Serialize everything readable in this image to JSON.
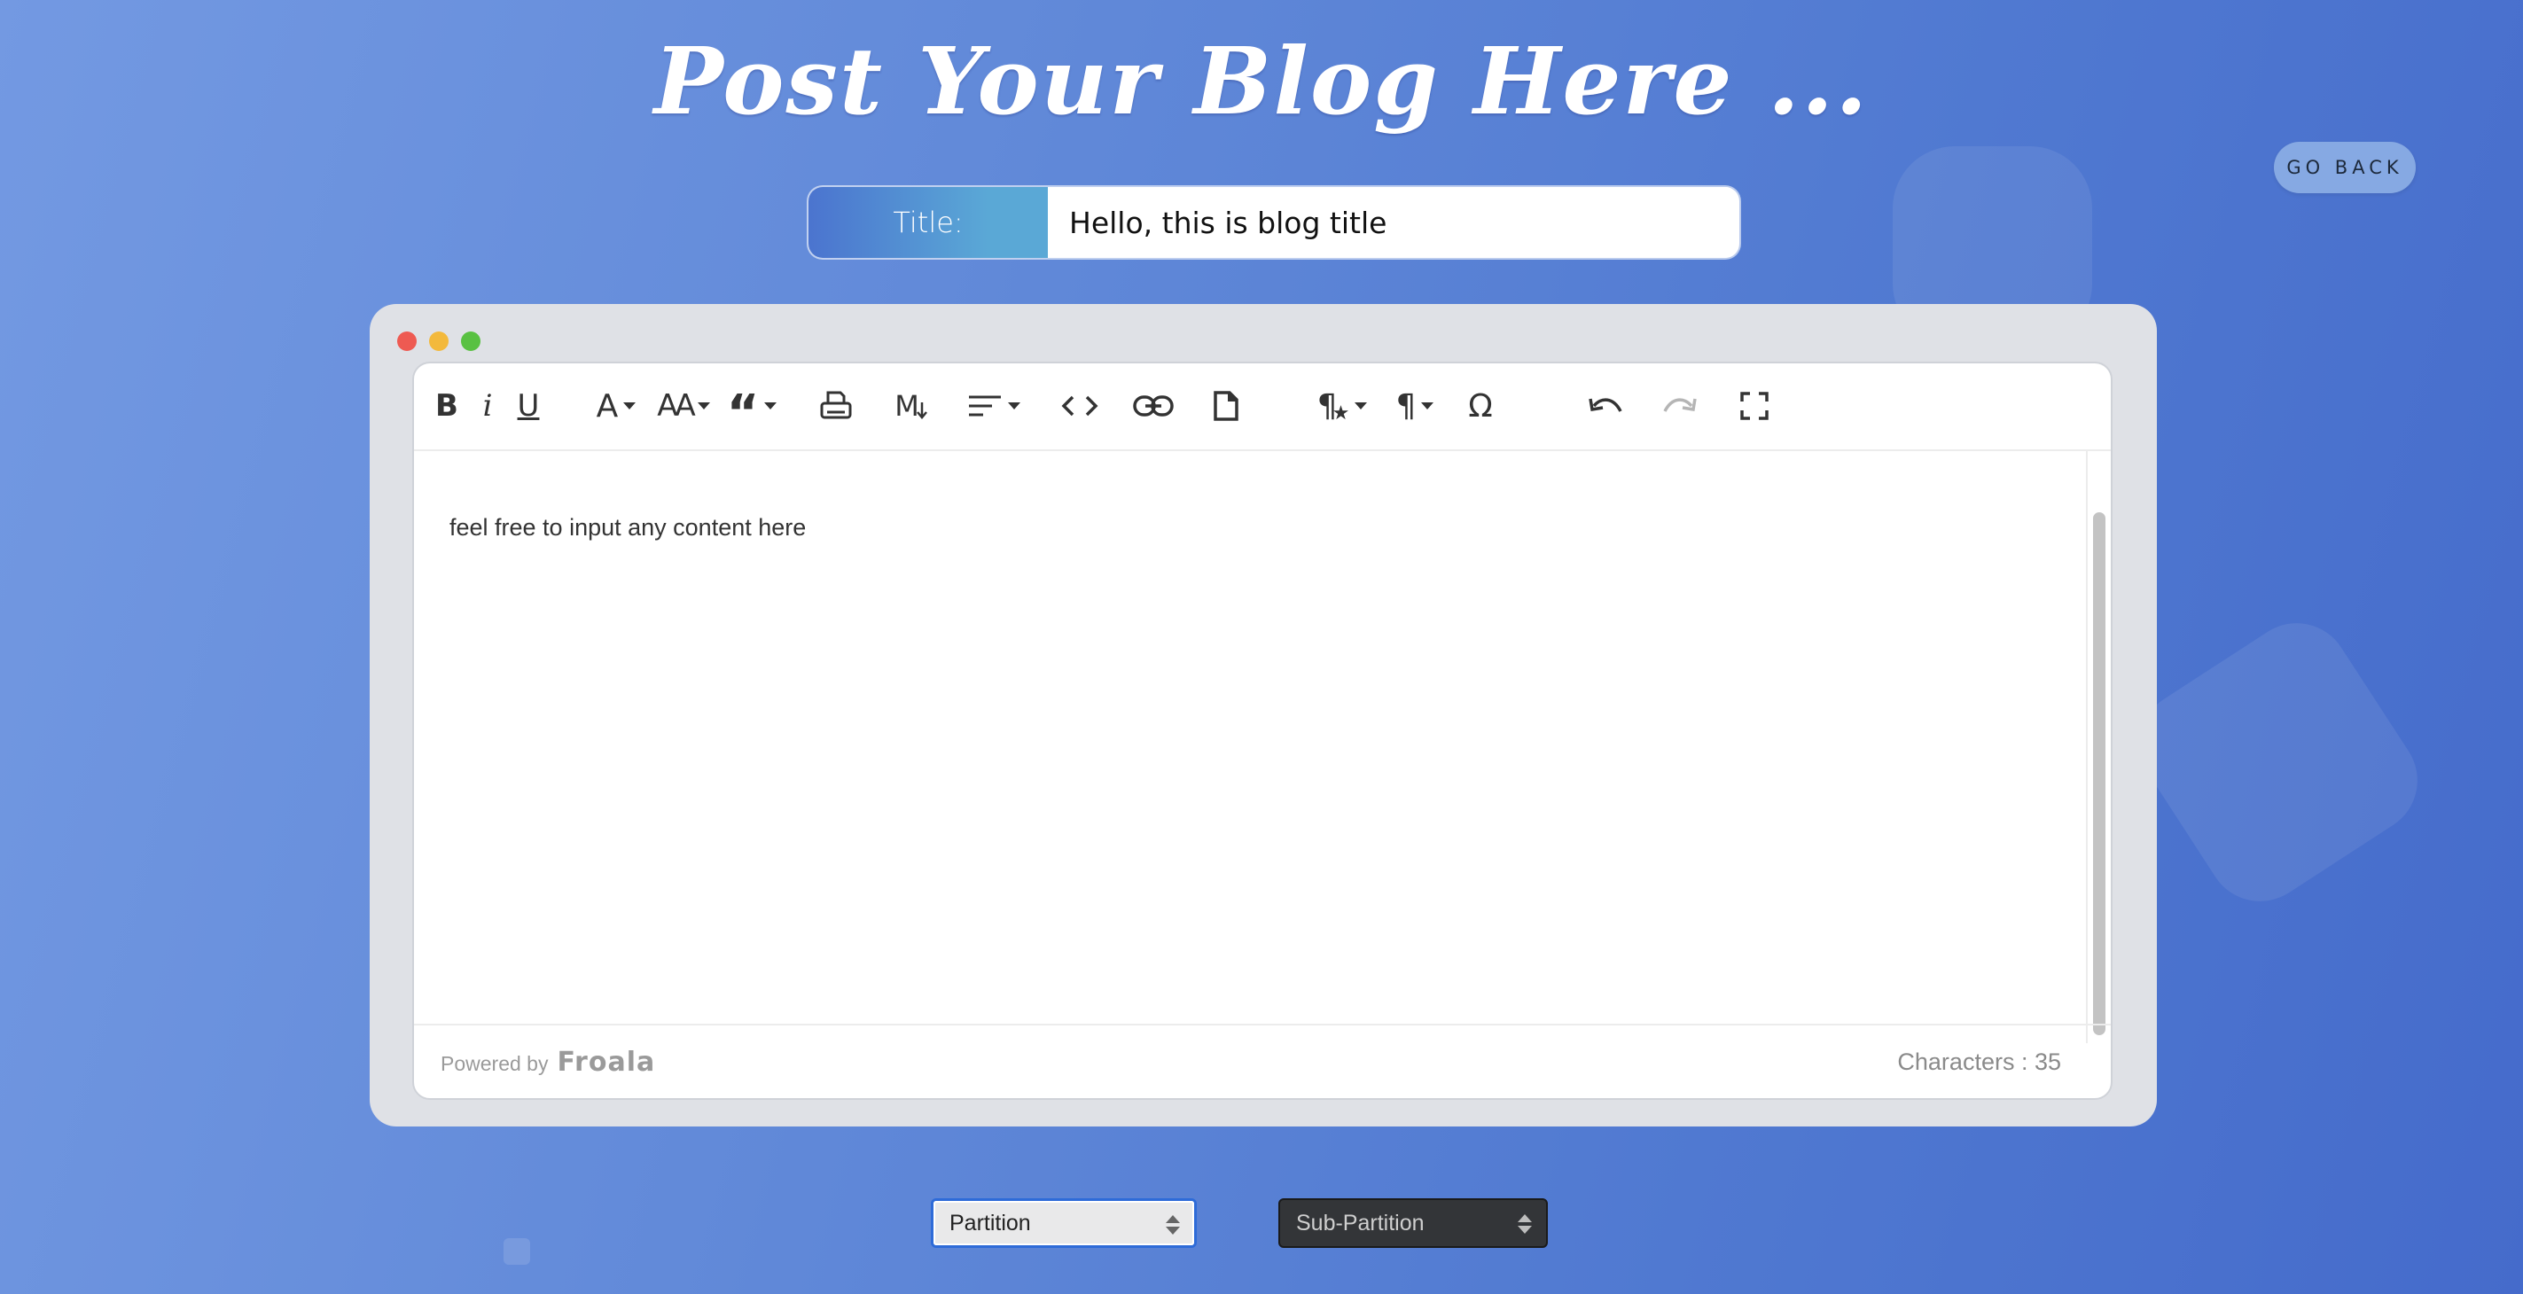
{
  "page": {
    "heading": "Post Your Blog Here ...",
    "go_back": "GO BACK"
  },
  "title_field": {
    "label": "Title:",
    "value": "Hello, this is blog title"
  },
  "toolbar": {
    "bold": "B",
    "italic": "i",
    "underline": "U",
    "font_family": "A",
    "font_size": "AA",
    "quote": "“",
    "print_icon": "printer-icon",
    "markdown": "M",
    "align_icon": "align-left-icon",
    "code_icon": "code-view-icon",
    "link_icon": "link-icon",
    "file_icon": "file-icon",
    "paragraph_style": "¶",
    "paragraph_format": "¶",
    "special_chars": "Ω",
    "undo_icon": "undo-icon",
    "redo_icon": "redo-icon",
    "fullscreen_icon": "fullscreen-icon"
  },
  "editor": {
    "content": "feel free to input any content here"
  },
  "footer": {
    "powered_by": "Powered by",
    "brand": "Froala",
    "characters": "Characters : 35"
  },
  "selects": {
    "partition": "Partition",
    "sub_partition": "Sub-Partition"
  },
  "colors": {
    "background_start": "#7399e2",
    "background_end": "#456bcb",
    "title_label_gradient": [
      "#4b74cf",
      "#5aa8d6"
    ],
    "window_bg": "#dfe1e6",
    "traffic_lights": [
      "#ee5a52",
      "#f3b93c",
      "#59c142"
    ]
  }
}
